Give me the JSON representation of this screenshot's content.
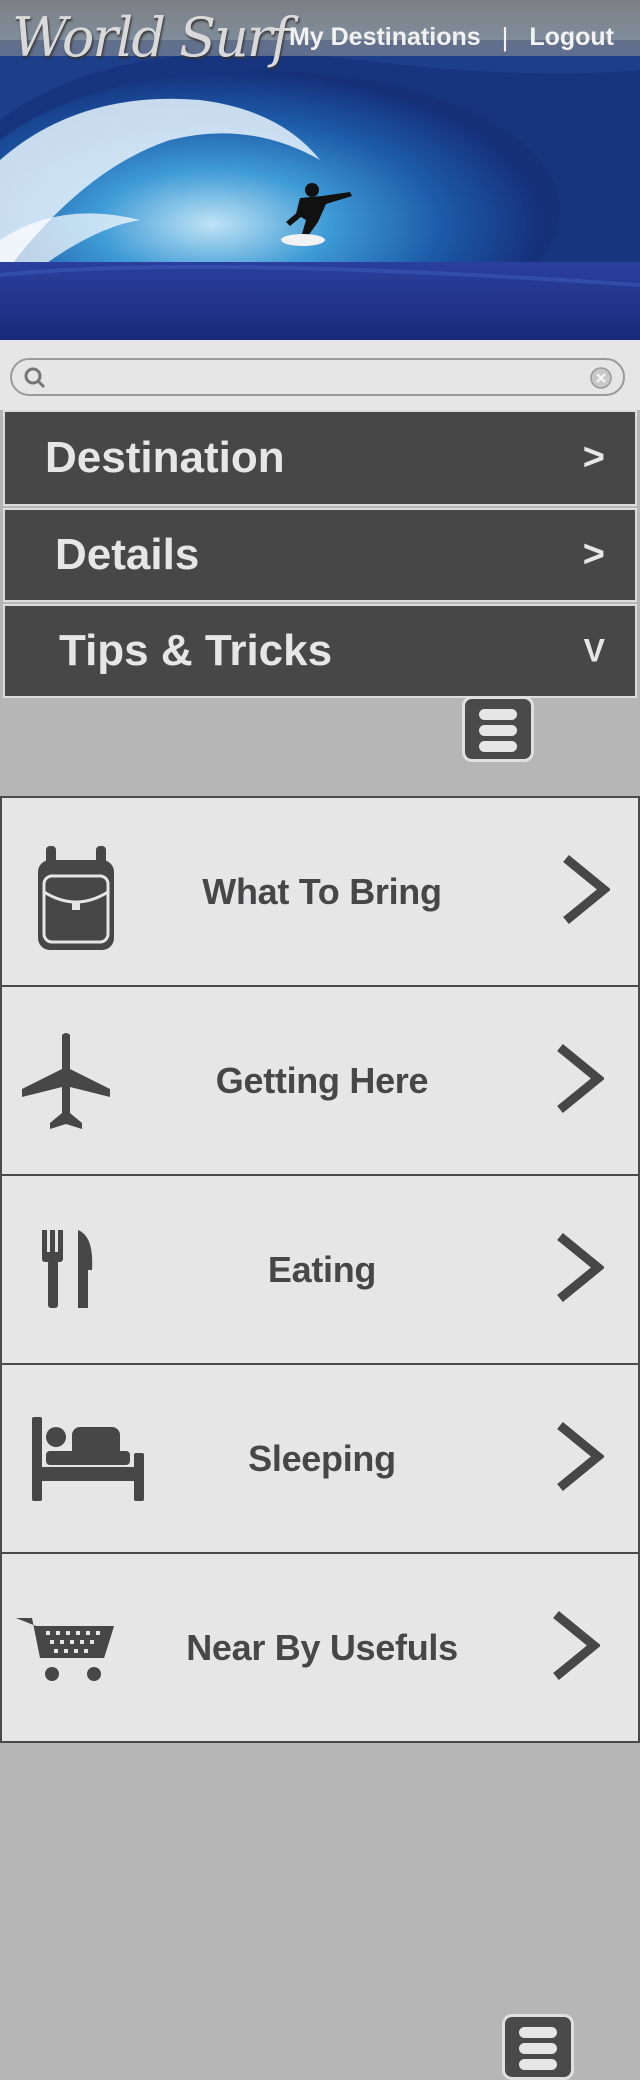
{
  "header": {
    "logo_text": "World Surf",
    "nav": [
      "My Destinations",
      "Logout"
    ],
    "separator": "|"
  },
  "search": {
    "placeholder": "",
    "value": ""
  },
  "accordion": [
    {
      "label": "Destination",
      "indicator": ">"
    },
    {
      "label": "Details",
      "indicator": ">"
    },
    {
      "label": "Tips & Tricks",
      "indicator": "V"
    }
  ],
  "tips": [
    {
      "label": "What To Bring",
      "icon": "backpack-icon"
    },
    {
      "label": "Getting Here",
      "icon": "airplane-icon"
    },
    {
      "label": "Eating",
      "icon": "fork-knife-icon"
    },
    {
      "label": "Sleeping",
      "icon": "bed-icon"
    },
    {
      "label": "Near By Usefuls",
      "icon": "shopping-cart-icon"
    }
  ],
  "colors": {
    "dark_gray": "#474747",
    "panel": "#e6e6e7",
    "background": "#b6b6b6",
    "text_light": "#e6e6e6"
  }
}
